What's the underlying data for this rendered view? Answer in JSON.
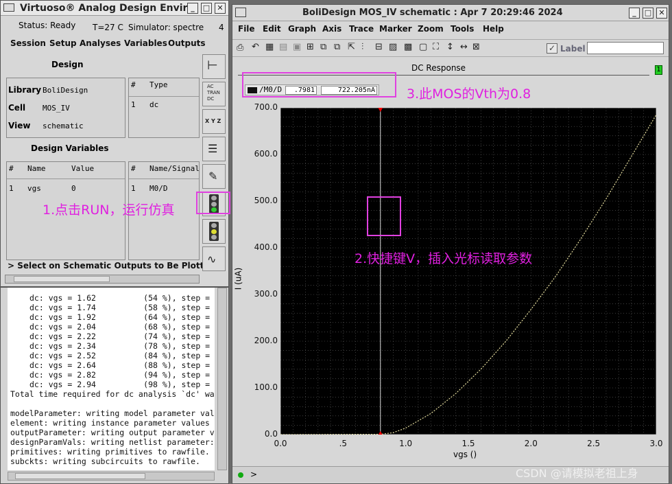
{
  "left_window": {
    "title": "Virtuoso® Analog Design Enviro",
    "status": "Status: Ready",
    "temp": "T=27 C",
    "simulator": "Simulator: spectre",
    "count": "4",
    "menu": [
      "Session",
      "Setup",
      "Analyses",
      "Variables",
      "Outputs"
    ],
    "design_heading": "Design",
    "design": {
      "library_label": "Library",
      "library": "BoliDesign",
      "cell_label": "Cell",
      "cell": "MOS_IV",
      "view_label": "View",
      "view": "schematic"
    },
    "analyses": {
      "col_num": "#",
      "col_type": "Type",
      "row_num": "1",
      "row_type": "dc"
    },
    "dv_heading": "Design Variables",
    "dv": {
      "col_num": "#",
      "col_name": "Name",
      "col_value": "Value",
      "row_num": "1",
      "row_name": "vgs",
      "row_value": "0"
    },
    "outputs": {
      "col_num": "#",
      "col_name": "Name/Signal",
      "row_num": "1",
      "row_name": "M0/D"
    },
    "status_msg": "> Select on Schematic Outputs to Be Plotted",
    "tool_icons": [
      "transistor-icon",
      "ac-tran-dc-icon",
      "xyz-icon",
      "netlist-icon",
      "pencil-icon",
      "run-icon",
      "stop-icon",
      "plot-icon"
    ],
    "ac_tran_dc": [
      "AC",
      "TRAN",
      "DC"
    ],
    "xyz": "X Y Z"
  },
  "log": [
    "dc: vgs = 1.62          (54 %), step =",
    "dc: vgs = 1.74          (58 %), step =",
    "dc: vgs = 1.92          (64 %), step =",
    "dc: vgs = 2.04          (68 %), step =",
    "dc: vgs = 2.22          (74 %), step =",
    "dc: vgs = 2.34          (78 %), step =",
    "dc: vgs = 2.52          (84 %), step =",
    "dc: vgs = 2.64          (88 %), step =",
    "dc: vgs = 2.82          (94 %), step =",
    "dc: vgs = 2.94          (98 %), step =",
    "Total time required for dc analysis `dc' wa",
    "",
    "modelParameter: writing model parameter val",
    "element: writing instance parameter values",
    "outputParameter: writing output parameter v",
    "designParamVals: writing netlist parameter:",
    "primitives: writing primitives to rawfile.",
    "subckts: writing subcircuits to rawfile."
  ],
  "right_window": {
    "title": "BoliDesign MOS_IV schematic : Apr  7 20:29:46 2024",
    "menu": [
      "File",
      "Edit",
      "Graph",
      "Axis",
      "Trace",
      "Marker",
      "Zoom",
      "Tools",
      "Help"
    ],
    "label_text": "Label",
    "plot_title": "DC Response",
    "subwindow": "1",
    "trace_name": "/M0/D",
    "cursor_x": ".7981",
    "cursor_y": "722.205nA",
    "prompt": ">"
  },
  "chart_data": {
    "type": "line",
    "title": "DC Response",
    "xlabel": "vgs ()",
    "ylabel": "I (uA)",
    "xlim": [
      0,
      3.0
    ],
    "ylim": [
      0,
      700
    ],
    "xticks": [
      "0.0",
      ".5",
      "1.0",
      "1.5",
      "2.0",
      "2.5",
      "3.0"
    ],
    "yticks": [
      "0.0",
      "100.0",
      "200.0",
      "300.0",
      "400.0",
      "500.0",
      "600.0",
      "700.0"
    ],
    "series": [
      {
        "name": "/M0/D",
        "color": "#e8e0a0",
        "x": [
          0,
          0.8,
          0.9,
          1.0,
          1.2,
          1.4,
          1.6,
          1.8,
          2.0,
          2.2,
          2.4,
          2.6,
          2.8,
          3.0
        ],
        "y": [
          0,
          0.7,
          4,
          14,
          45,
          88,
          140,
          200,
          268,
          340,
          420,
          505,
          595,
          685
        ]
      }
    ],
    "cursor_x": 0.7981
  },
  "annotations": {
    "a1": "1.点击RUN，运行仿真",
    "a2": "2.快捷键V，插入光标读取参数",
    "a3": "3.此MOS的Vth为0.8"
  },
  "watermark": "CSDN @请模拟老祖上身"
}
